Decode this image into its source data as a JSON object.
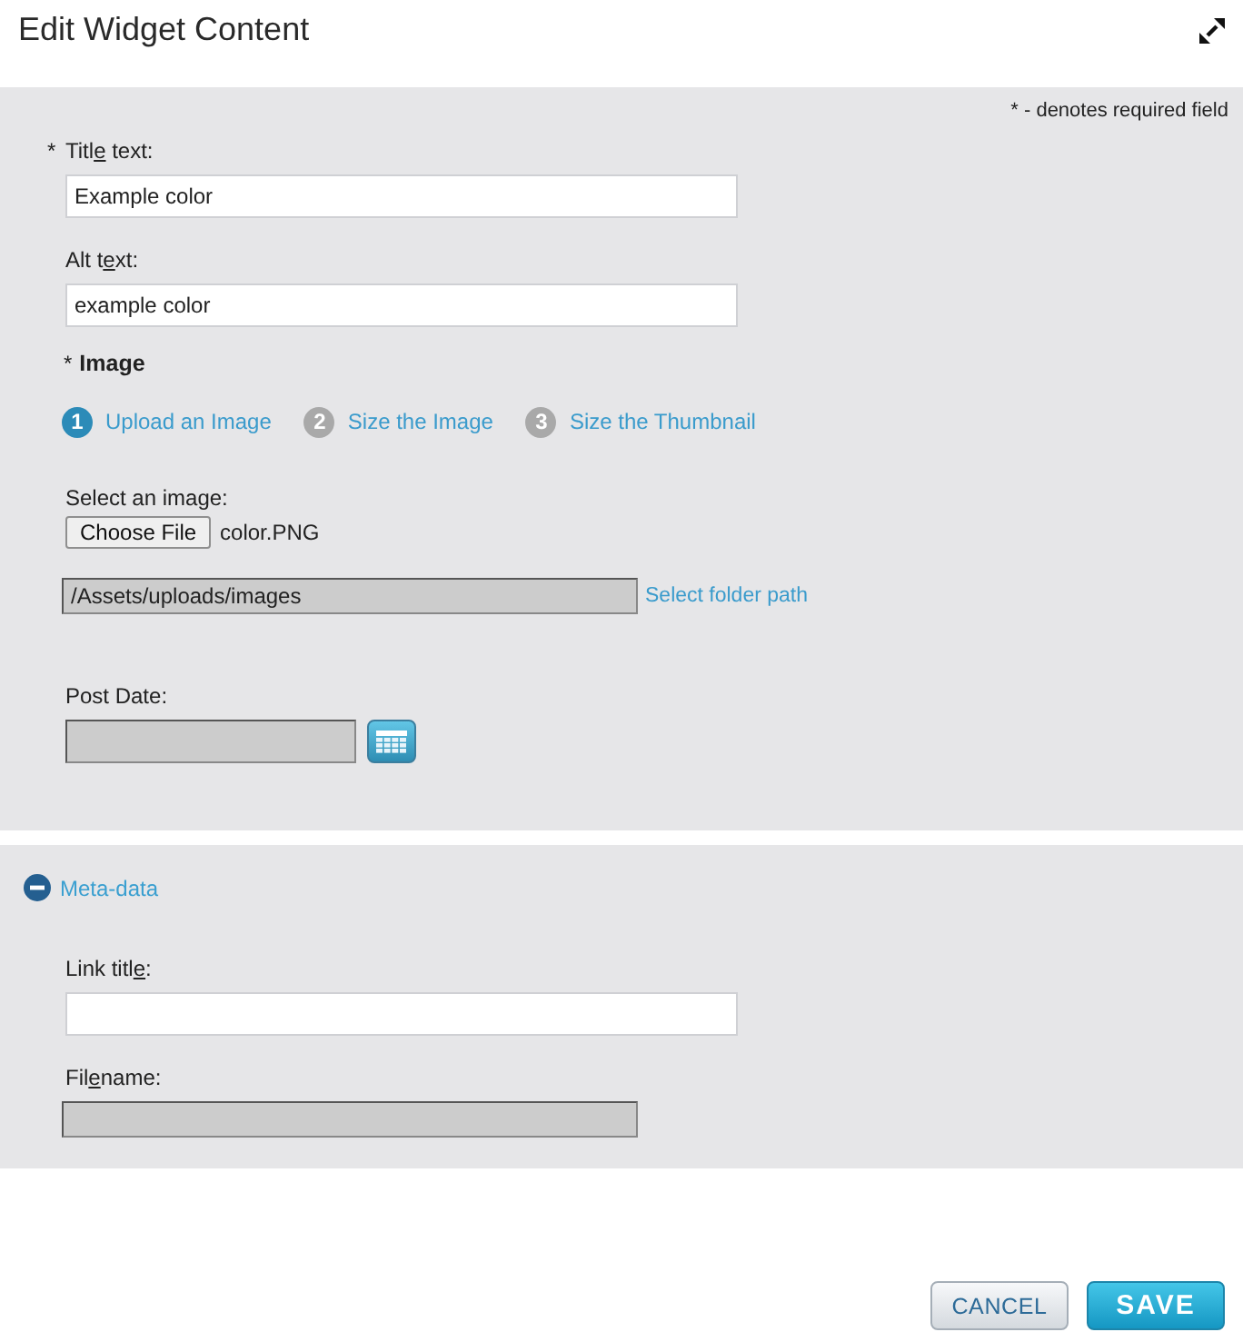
{
  "window": {
    "title": "Edit Widget Content"
  },
  "required_note": "* - denotes required field",
  "fields": [
    {
      "required_mark": "*",
      "label": {
        "before": "Titl",
        "access_key": "e",
        "after": " text:"
      },
      "value": "Example color",
      "disabled": false
    },
    {
      "label": {
        "before": "Alt t",
        "access_key": "e",
        "after": "xt:"
      },
      "value": "example color",
      "disabled": false
    }
  ],
  "image": {
    "required_mark": "*",
    "heading": "Image",
    "steps": [
      {
        "number": "1",
        "label": "Upload an Image",
        "selected": true
      },
      {
        "number": "2",
        "label": "Size the Image",
        "selected": false
      },
      {
        "number": "3",
        "label": "Size the Thumbnail",
        "selected": false
      }
    ],
    "file_label": "Select an image:",
    "file_button": "Choose File",
    "file_name": "color.PNG",
    "folder_path": {
      "value": "/Assets/uploads/images",
      "disabled": true
    },
    "folder_link": "Select folder path"
  },
  "post_date": {
    "label": "Post Date:",
    "disabled": true
  },
  "meta_data": {
    "title": "Meta-data",
    "expanded": true,
    "fields": [
      {
        "label": {
          "before": "Link titl",
          "access_key": "e",
          "after": ":"
        },
        "disabled": false
      },
      {
        "label": {
          "before": "Fil",
          "access_key": "e",
          "after": "name:"
        },
        "disabled": true
      }
    ]
  },
  "buttons": [
    {
      "kind": "secondary",
      "label": "CANCEL"
    },
    {
      "kind": "primary",
      "label": "SAVE"
    }
  ]
}
